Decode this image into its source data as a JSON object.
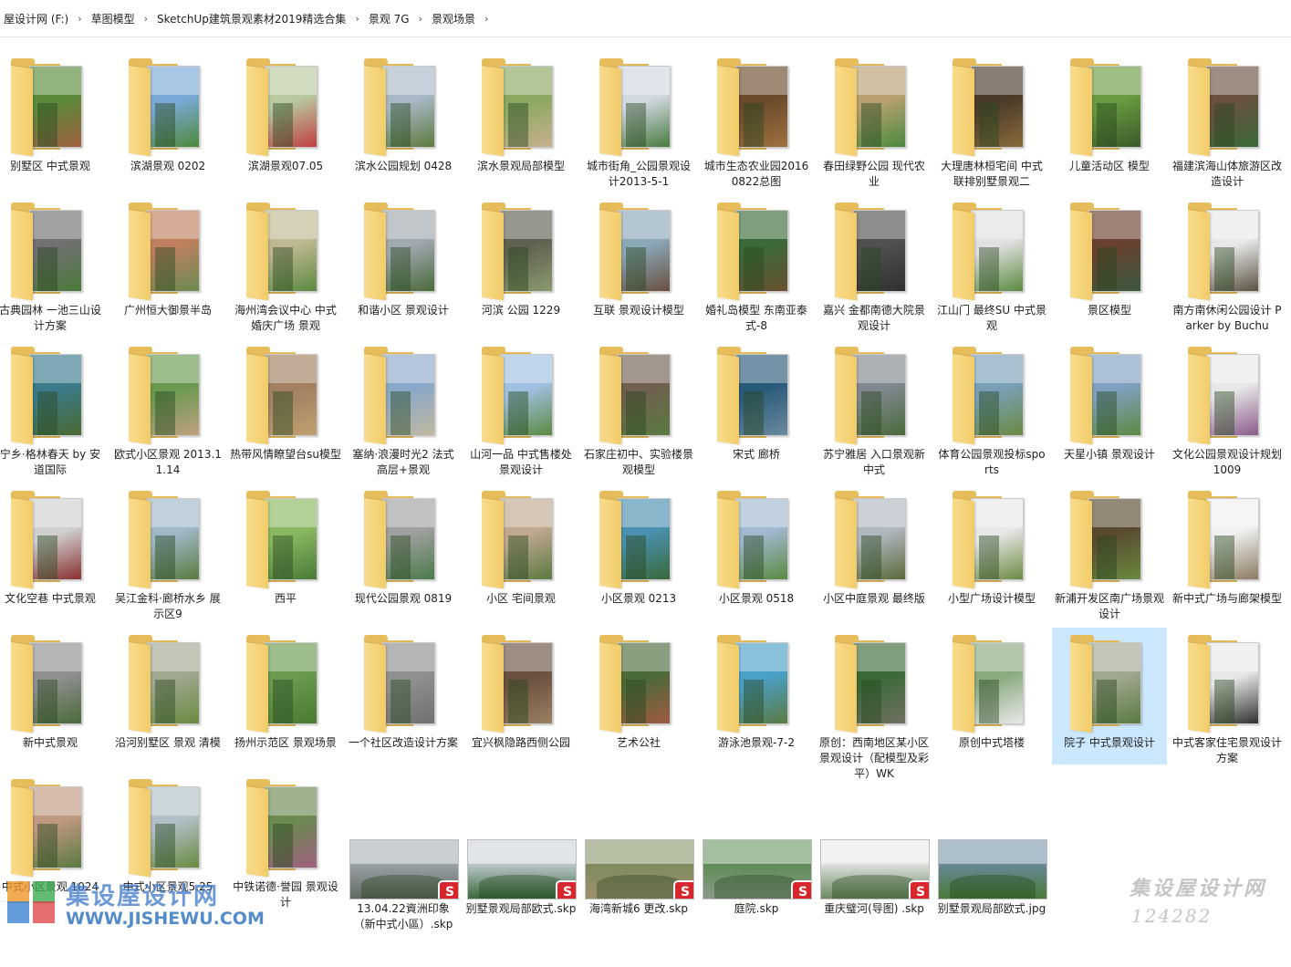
{
  "breadcrumb": [
    "屋设计网 (F:)",
    "草图模型",
    "SketchUp建筑景观素材2019精选合集",
    "景观 7G",
    "景观场景"
  ],
  "folders": [
    {
      "name": "别墅区 中式景观",
      "colors": [
        "#5a8a3a",
        "#a06040"
      ]
    },
    {
      "name": "滨湖景观 0202",
      "colors": [
        "#7aa9d8",
        "#4d8a3a"
      ]
    },
    {
      "name": "滨湖景观07.05",
      "colors": [
        "#b8c9a0",
        "#c04040"
      ]
    },
    {
      "name": "滨水公园规划 0428",
      "colors": [
        "#a9b8c8",
        "#5d7a3d"
      ]
    },
    {
      "name": "滨水景观局部模型",
      "colors": [
        "#8aa860",
        "#c9b090"
      ]
    },
    {
      "name": "城市街角_公园景观设计2013-5-1",
      "colors": [
        "#d0d8e0",
        "#4a7a40"
      ]
    },
    {
      "name": "城市生态农业园20160822总图",
      "colors": [
        "#6a4a2a",
        "#a07040"
      ]
    },
    {
      "name": "春田绿野公园 现代农业",
      "colors": [
        "#b8a070",
        "#4a8a40"
      ]
    },
    {
      "name": "大理唐林桓宅间 中式联排别墅景观二",
      "colors": [
        "#4a3a2a",
        "#8a6a3a"
      ]
    },
    {
      "name": "儿童活动区 模型",
      "colors": [
        "#6a9a40",
        "#3a5a2a"
      ]
    },
    {
      "name": "福建滨海山体旅游区改造设计",
      "colors": [
        "#6a5040",
        "#3a6a3a"
      ]
    },
    {
      "name": "古典园林 一池三山设计方案",
      "colors": [
        "#707070",
        "#4a7a3a"
      ]
    },
    {
      "name": "广州恒大御景半岛",
      "colors": [
        "#c08060",
        "#6a8a50"
      ]
    },
    {
      "name": "海州湾会议中心 中式婚庆广场 景观",
      "colors": [
        "#c0b890",
        "#5a8a40"
      ]
    },
    {
      "name": "和谐小区 景观设计",
      "colors": [
        "#a0a8b0",
        "#4a6a3a"
      ]
    },
    {
      "name": "河滨 公园 1229",
      "colors": [
        "#606050",
        "#8a9a70"
      ]
    },
    {
      "name": "互联 景观设计模型",
      "colors": [
        "#8aa8b8",
        "#6a5040"
      ]
    },
    {
      "name": "婚礼岛模型 东南亚泰式-8",
      "colors": [
        "#3a6a3a",
        "#6a5030"
      ]
    },
    {
      "name": "嘉兴 金都南德大院景观设计",
      "colors": [
        "#505050",
        "#303030"
      ]
    },
    {
      "name": "江山门 最终SU 中式景观",
      "colors": [
        "#e0e0e0",
        "#5a8a40"
      ]
    },
    {
      "name": "景区模型",
      "colors": [
        "#6a4030",
        "#3a5a40"
      ]
    },
    {
      "name": "南方南休闲公园设计 Parker by Buchu",
      "colors": [
        "#e8e8e8",
        "#5a5040"
      ]
    },
    {
      "name": "宁乡·格林春天 by 安道国际",
      "colors": [
        "#3a7a8a",
        "#4a6a30"
      ]
    },
    {
      "name": "欧式小区景观 2013.11.14",
      "colors": [
        "#6a9a50",
        "#c0a080"
      ]
    },
    {
      "name": "热带风情瞭望台su模型",
      "colors": [
        "#a08060",
        "#c0a070"
      ]
    },
    {
      "name": "塞纳·浪漫时光2 法式高层+景观",
      "colors": [
        "#8aa8c8",
        "#c0b8a0"
      ]
    },
    {
      "name": "山河一品 中式售楼处景观设计",
      "colors": [
        "#a0c0e0",
        "#5a8a40"
      ]
    },
    {
      "name": "石家庄初中、实验楼景观模型",
      "colors": [
        "#706050",
        "#5a7a40"
      ]
    },
    {
      "name": "宋式 廊桥",
      "colors": [
        "#2a5a7a",
        "#6a8aa0"
      ]
    },
    {
      "name": "苏宁雅居 入口景观新中式",
      "colors": [
        "#808890",
        "#4a6a3a"
      ]
    },
    {
      "name": "体育公园景观投标sports",
      "colors": [
        "#7aa0b8",
        "#6a8a40"
      ]
    },
    {
      "name": "天星小镇 景观设计",
      "colors": [
        "#80a0c0",
        "#5a8a40"
      ]
    },
    {
      "name": "文化公园景观设计规划1009",
      "colors": [
        "#e8e8e8",
        "#8a5a8a"
      ]
    },
    {
      "name": "文化空巷 中式景观",
      "colors": [
        "#d0d0d0",
        "#8a3030"
      ]
    },
    {
      "name": "吴江金科·廊桥水乡 展示区9",
      "colors": [
        "#a0b8c8",
        "#5a7a40"
      ]
    },
    {
      "name": "西平",
      "colors": [
        "#8ab860",
        "#4a7a3a"
      ]
    },
    {
      "name": "现代公园景观 0819",
      "colors": [
        "#a0a0a0",
        "#4a7a4a"
      ]
    },
    {
      "name": "小区 宅间景观",
      "colors": [
        "#c0a890",
        "#5a7a40"
      ]
    },
    {
      "name": "小区景观 0213",
      "colors": [
        "#4a90b0",
        "#3a6a3a"
      ]
    },
    {
      "name": "小区景观 0518",
      "colors": [
        "#a0b8d0",
        "#5a8a40"
      ]
    },
    {
      "name": "小区中庭景观 最终版",
      "colors": [
        "#b0b8c0",
        "#5a6a3a"
      ]
    },
    {
      "name": "小型广场设计模型",
      "colors": [
        "#e8e8e8",
        "#6a8a40"
      ]
    },
    {
      "name": "新浦开发区南广场景观设计",
      "colors": [
        "#5a4a30",
        "#6a8a40"
      ]
    },
    {
      "name": "新中式广场与廊架模型",
      "colors": [
        "#f0f0f0",
        "#8a7a60"
      ]
    },
    {
      "name": "新中式景观",
      "colors": [
        "#909090",
        "#4a6a3a"
      ]
    },
    {
      "name": "沿河别墅区 景观 清模",
      "colors": [
        "#a0a890",
        "#6a8a40"
      ]
    },
    {
      "name": "扬州示范区 景观场景",
      "colors": [
        "#6a9a50",
        "#4a7a30"
      ]
    },
    {
      "name": "一个社区改造设计方案",
      "colors": [
        "#909090",
        "#707070"
      ]
    },
    {
      "name": "宜兴枫隐路西侧公园",
      "colors": [
        "#6a5040",
        "#9a8060"
      ]
    },
    {
      "name": "艺术公社",
      "colors": [
        "#4a6a3a",
        "#a05a40"
      ]
    },
    {
      "name": "游泳池景观-7-2",
      "colors": [
        "#4aa0c8",
        "#5a7a40"
      ]
    },
    {
      "name": "原创：西南地区某小区景观设计（配模型及彩平）WK",
      "colors": [
        "#3a6a3a",
        "#707060"
      ]
    },
    {
      "name": "原创中式塔楼",
      "colors": [
        "#8aaa80",
        "#e8e8e8"
      ]
    },
    {
      "name": "院子 中式景观设计",
      "colors": [
        "#a0a890",
        "#5a7a40"
      ]
    },
    {
      "name": "中式客家住宅景观设计方案",
      "colors": [
        "#e8e8e8",
        "#303030"
      ]
    },
    {
      "name": "中式小区景观 1024",
      "colors": [
        "#c09880",
        "#5a7a40"
      ]
    },
    {
      "name": "中式小区景观5.25",
      "colors": [
        "#b0c0c8",
        "#6a8a40"
      ]
    },
    {
      "name": "中铁诺德·誉园 景观设计",
      "colors": [
        "#6a8a50",
        "#a06080"
      ]
    }
  ],
  "files": [
    {
      "name": "13.04.22資洲印象（新中式小區）.skp",
      "sketchup": true,
      "colors": [
        "#a0a8b0",
        "#606860"
      ]
    },
    {
      "name": "别墅景观局部欧式.skp",
      "sketchup": true,
      "colors": [
        "#c8d0d8",
        "#3a6a3a"
      ]
    },
    {
      "name": "海湾新城6  更改.skp",
      "sketchup": true,
      "colors": [
        "#7a8a5a",
        "#a09070"
      ]
    },
    {
      "name": "庭院.skp",
      "sketchup": true,
      "colors": [
        "#5a8a50",
        "#8a9a8a"
      ]
    },
    {
      "name": "重庆璧河(导图) .skp",
      "sketchup": true,
      "colors": [
        "#e8e8e8",
        "#6a8a60"
      ]
    },
    {
      "name": "别墅景观局部欧式.jpg",
      "sketchup": false,
      "colors": [
        "#6a8aa0",
        "#4a7a3a"
      ]
    }
  ],
  "selected_index": 53,
  "sketchup_badge_glyph": "S",
  "watermark": {
    "site_cn": "集设屋设计网",
    "site_url": "WWW.JISHEWU.COM",
    "stamp_cn": "集设屋设计网",
    "stamp_no": "124282"
  },
  "colors": {
    "folder": "#e7bd5b",
    "selection": "#cce8ff",
    "sketchup_red": "#d9262c"
  }
}
